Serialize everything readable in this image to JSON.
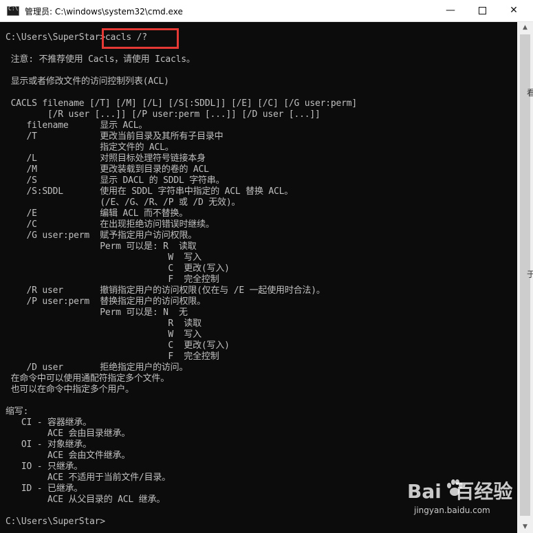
{
  "window": {
    "title": "管理员: C:\\windows\\system32\\cmd.exe",
    "app_icon": "cmd-icon",
    "icon_glyph": "C:\\",
    "controls": {
      "minimize": "—",
      "close": "✕"
    }
  },
  "console": {
    "lines": [
      "C:\\Users\\SuperStar>cacls /?",
      "",
      " 注意: 不推荐使用 Cacls，请使用 Icacls。",
      "",
      " 显示或者修改文件的访问控制列表(ACL)",
      "",
      " CACLS filename [/T] [/M] [/L] [/S[:SDDL]] [/E] [/C] [/G user:perm]",
      "        [/R user [...]] [/P user:perm [...]] [/D user [...]]",
      "    filename      显示 ACL。",
      "    /T            更改当前目录及其所有子目录中",
      "                  指定文件的 ACL。",
      "    /L            对照目标处理符号链接本身",
      "    /M            更改装载到目录的卷的 ACL",
      "    /S            显示 DACL 的 SDDL 字符串。",
      "    /S:SDDL       使用在 SDDL 字符串中指定的 ACL 替换 ACL。",
      "                  (/E、/G、/R、/P 或 /D 无效)。",
      "    /E            编辑 ACL 而不替换。",
      "    /C            在出现拒绝访问错误时继续。",
      "    /G user:perm  赋予指定用户访问权限。",
      "                  Perm 可以是: R  读取",
      "                               W  写入",
      "                               C  更改(写入)",
      "                               F  完全控制",
      "    /R user       撤销指定用户的访问权限(仅在与 /E 一起使用时合法)。",
      "    /P user:perm  替换指定用户的访问权限。",
      "                  Perm 可以是: N  无",
      "                               R  读取",
      "                               W  写入",
      "                               C  更改(写入)",
      "                               F  完全控制",
      "    /D user       拒绝指定用户的访问。",
      " 在命令中可以使用通配符指定多个文件。",
      " 也可以在命令中指定多个用户。",
      "",
      "缩写:",
      "   CI - 容器继承。",
      "        ACE 会由目录继承。",
      "   OI - 对象继承。",
      "        ACE 会由文件继承。",
      "   IO - 只继承。",
      "        ACE 不适用于当前文件/目录。",
      "   ID - 已继承。",
      "        ACE 从父目录的 ACL 继承。",
      "",
      "C:\\Users\\SuperStar>"
    ],
    "highlight_color": "#e53935",
    "text_color": "#c0c0c0",
    "background": "#0c0c0c"
  },
  "edge_fragments": [
    "看",
    "于"
  ],
  "watermark": {
    "logo": "Bai  百经验",
    "url": "jingyan.baidu.com"
  }
}
